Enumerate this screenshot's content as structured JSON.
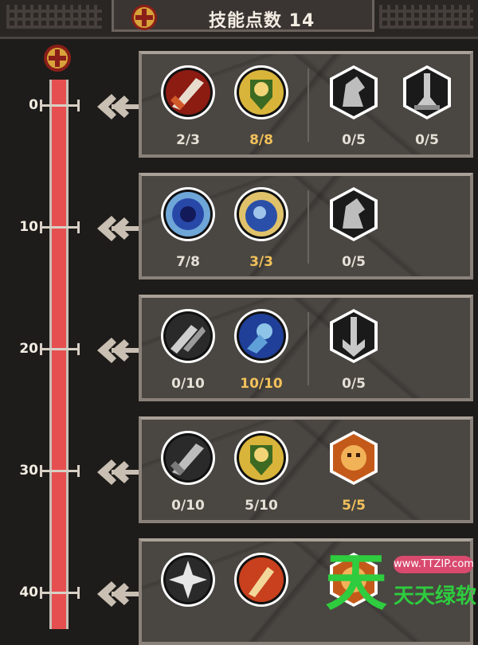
{
  "header": {
    "title": "技能点数 14",
    "coin_icon": "skill-point-coin-icon"
  },
  "track": {
    "progress_fraction": 1.0,
    "color": "#e64f50",
    "ticks": [
      "0",
      "10",
      "20",
      "30",
      "40"
    ]
  },
  "tiers": [
    {
      "skills": [
        {
          "icon": "fire-sword-skill-icon",
          "count": "2/3",
          "maxed": false
        },
        {
          "icon": "golden-knight-skill-icon",
          "count": "8/8",
          "maxed": true
        },
        {
          "icon": "locked-horse-head-skill-icon",
          "count": "0/5",
          "maxed": false
        },
        {
          "icon": "locked-sword-spire-skill-icon",
          "count": "0/5",
          "maxed": false
        }
      ]
    },
    {
      "skills": [
        {
          "icon": "blue-vortex-skill-icon",
          "count": "7/8",
          "maxed": false
        },
        {
          "icon": "blue-knight-skill-icon",
          "count": "3/3",
          "maxed": true
        },
        {
          "icon": "locked-horse-head-skill-icon",
          "count": "0/5",
          "maxed": false
        }
      ]
    },
    {
      "skills": [
        {
          "icon": "locked-dual-sword-skill-icon",
          "count": "0/10",
          "maxed": false
        },
        {
          "icon": "blue-mage-skill-icon",
          "count": "10/10",
          "maxed": true
        },
        {
          "icon": "locked-arrow-skill-icon",
          "count": "0/5",
          "maxed": false
        }
      ]
    },
    {
      "skills": [
        {
          "icon": "locked-sword-skill-icon",
          "count": "0/10",
          "maxed": false
        },
        {
          "icon": "golden-knight-skill-icon",
          "count": "5/10",
          "maxed": false
        },
        {
          "icon": "orange-beast-skill-icon",
          "count": "5/5",
          "maxed": true
        }
      ]
    },
    {
      "skills": [
        {
          "icon": "white-star-burst-skill-icon",
          "count": "",
          "maxed": false
        },
        {
          "icon": "fire-blade-skill-icon",
          "count": "",
          "maxed": false
        },
        {
          "icon": "orange-beast-skill-icon",
          "count": "",
          "maxed": false
        }
      ]
    }
  ],
  "watermark": {
    "big_char": "天",
    "url": "www.TTZIP.com",
    "brand": "天天绿软"
  }
}
